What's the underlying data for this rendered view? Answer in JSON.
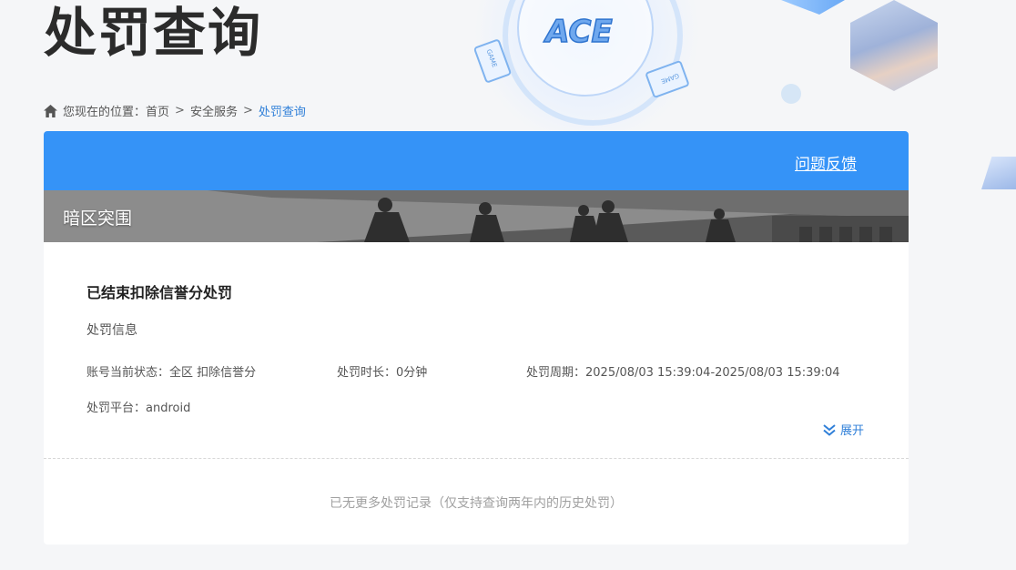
{
  "page": {
    "title": "处罚查询"
  },
  "decoration": {
    "logo_text": "ACE",
    "card_label": "GAME"
  },
  "breadcrumb": {
    "prefix": "您现在的位置：",
    "items": [
      "首页",
      "安全服务",
      "处罚查询"
    ],
    "separator": ">"
  },
  "panel": {
    "feedback_label": "问题反馈",
    "game_name": "暗区突围"
  },
  "record": {
    "title": "已结束扣除信誉分处罚",
    "section_label": "处罚信息",
    "status": "账号当前状态：全区 扣除信誉分",
    "duration": "处罚时长：0分钟",
    "period": "处罚周期：2025/08/03 15:39:04-2025/08/03 15:39:04",
    "platform": "处罚平台：android",
    "expand_label": "展开"
  },
  "footer_note": "已无更多处罚记录（仅支持查询两年内的历史处罚）",
  "colors": {
    "accent": "#3593f7",
    "link": "#2f7fd8",
    "background": "#f5f6f8"
  }
}
